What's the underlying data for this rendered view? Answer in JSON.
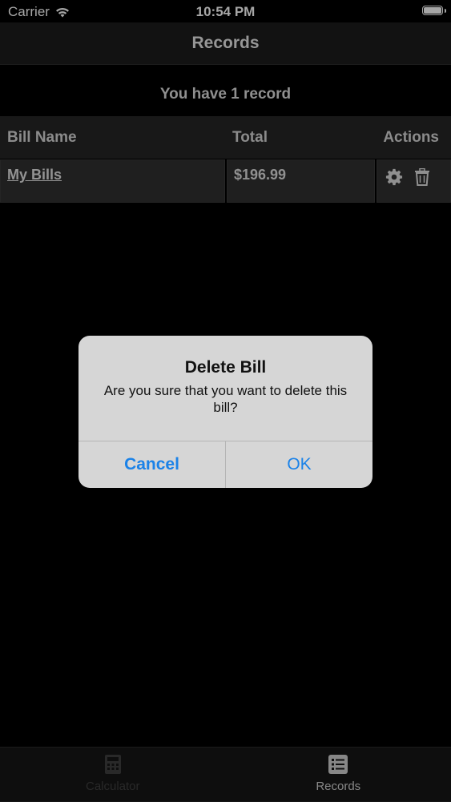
{
  "status_bar": {
    "carrier": "Carrier",
    "time": "10:54 PM"
  },
  "navbar": {
    "title": "Records"
  },
  "records": {
    "count_text": "You have 1 record",
    "columns": [
      "Bill Name",
      "Total",
      "Actions"
    ],
    "rows": [
      {
        "name": "My Bills",
        "total": "$196.99"
      }
    ]
  },
  "alert": {
    "title": "Delete Bill",
    "message": "Are you sure that you want to delete this bill?",
    "cancel": "Cancel",
    "ok": "OK"
  },
  "tabbar": {
    "tabs": [
      {
        "label": "Calculator",
        "icon": "calculator-icon",
        "active": false
      },
      {
        "label": "Records",
        "icon": "list-icon",
        "active": true
      }
    ]
  },
  "colors": {
    "accent": "#1a82e8",
    "background": "#000000",
    "alert_bg": "#d6d6d6"
  }
}
